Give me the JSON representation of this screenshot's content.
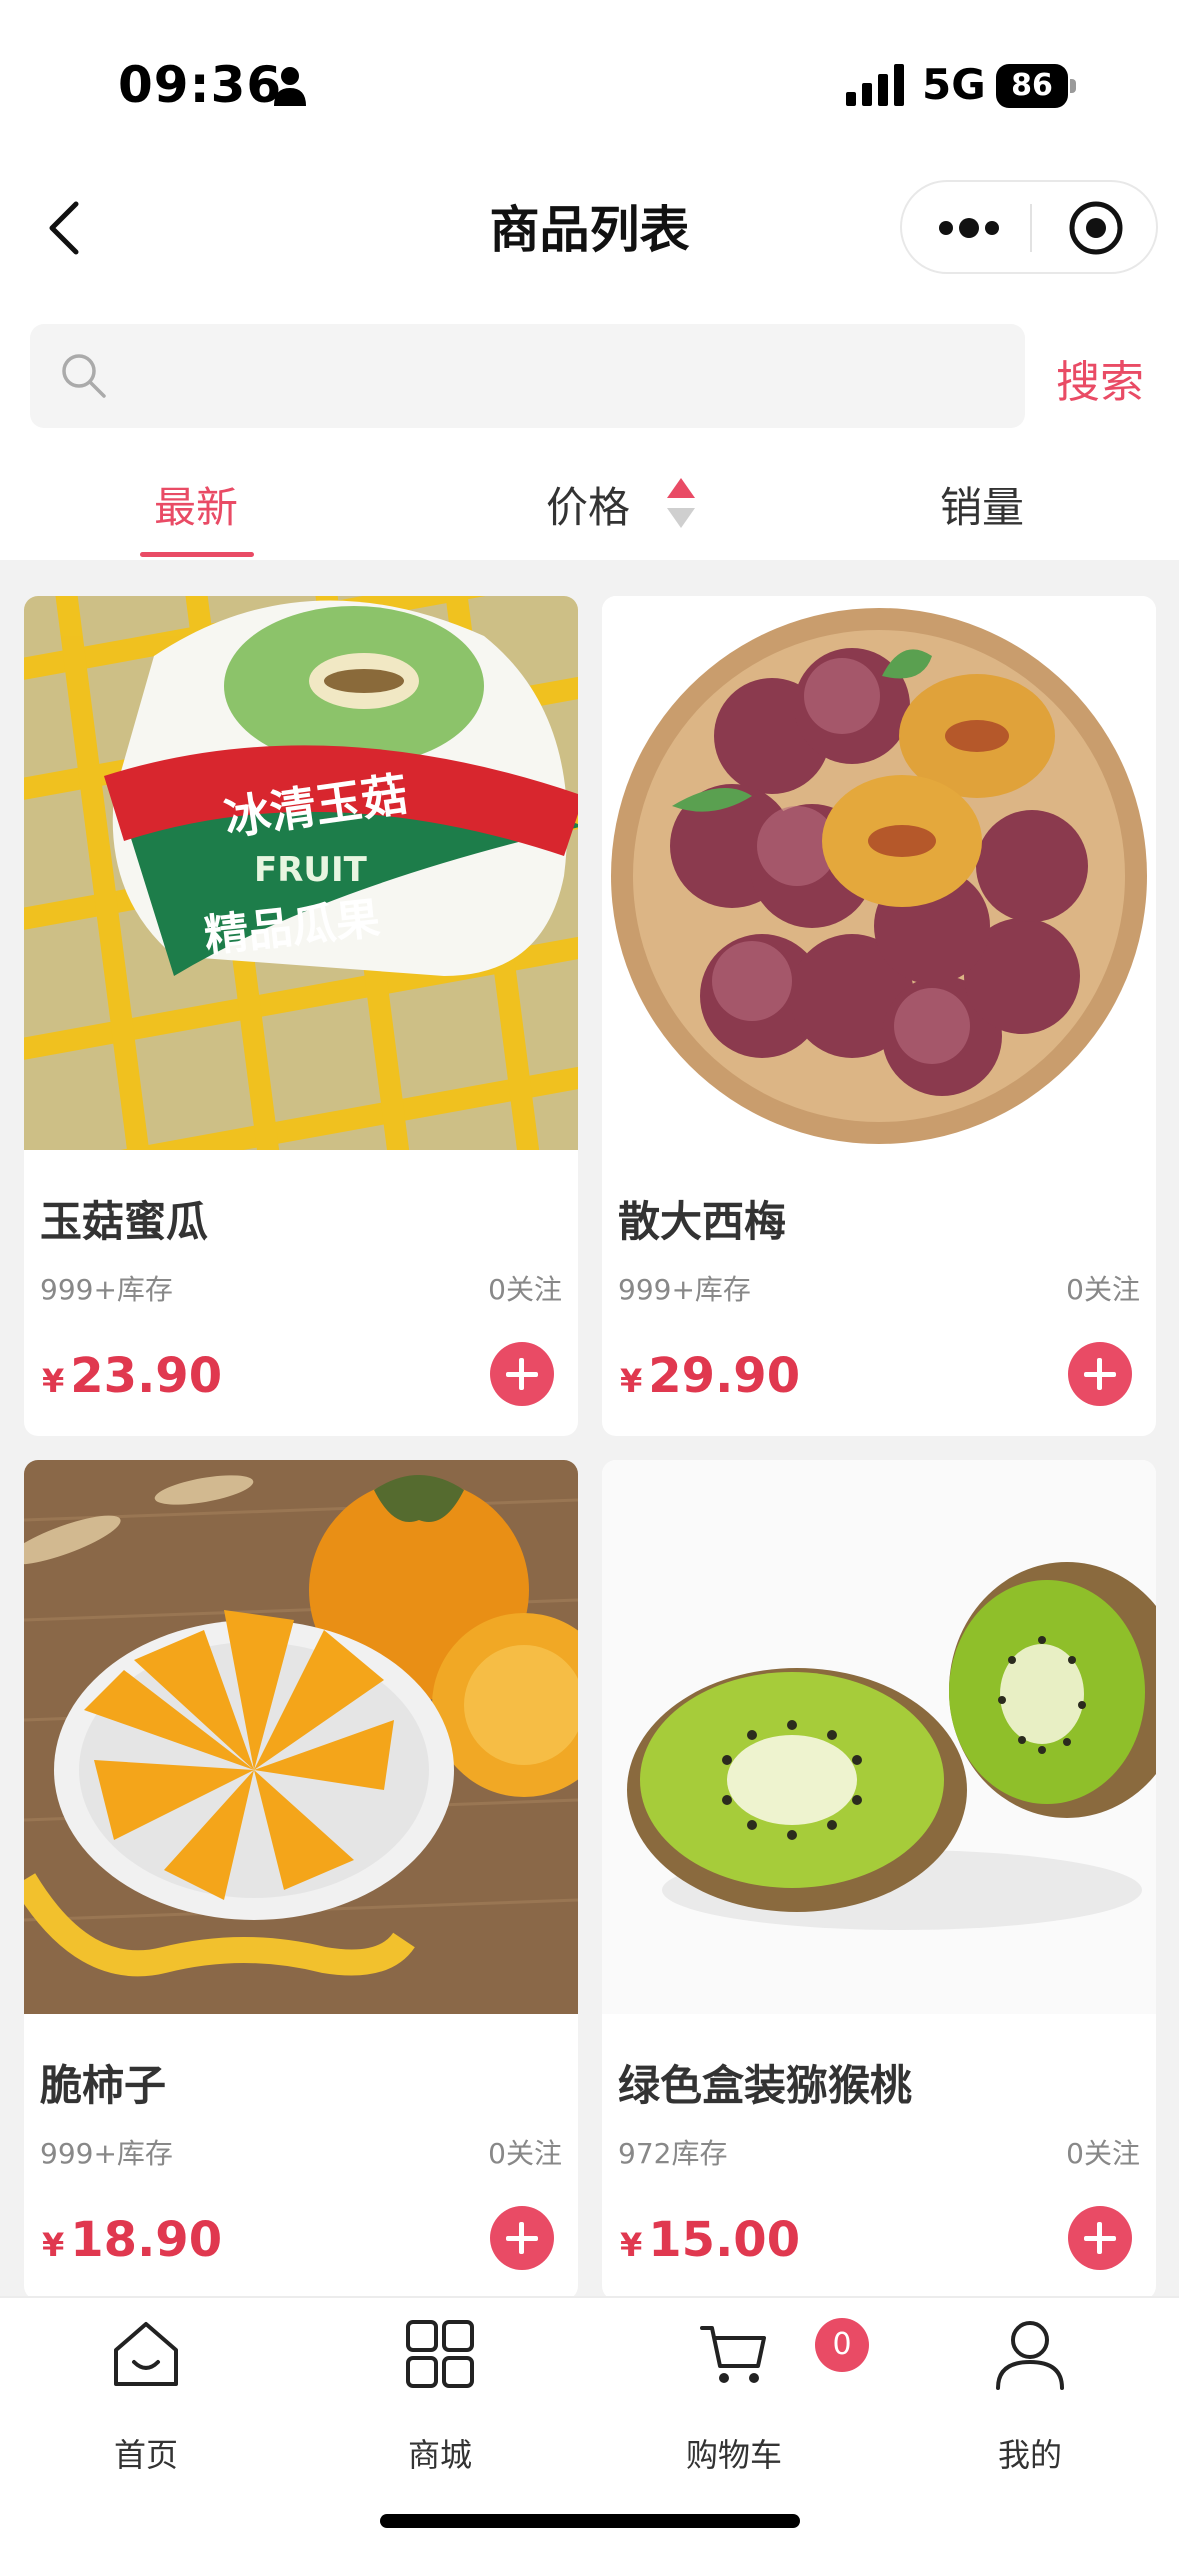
{
  "status_bar": {
    "time": "09:36",
    "network": "5G",
    "battery": "86"
  },
  "nav": {
    "title": "商品列表"
  },
  "search": {
    "placeholder": "",
    "button_label": "搜索"
  },
  "sort_tabs": [
    {
      "label": "最新",
      "active": true
    },
    {
      "label": "价格",
      "active": false
    },
    {
      "label": "销量",
      "active": false
    }
  ],
  "products": [
    {
      "name": "玉菇蜜瓜",
      "stock": "999+库存",
      "follow": "0关注",
      "currency": "¥",
      "price": "23.90",
      "image": "melon-image",
      "image_text": [
        "冰清玉菇",
        "FRUIT",
        "精品瓜果"
      ]
    },
    {
      "name": "散大西梅",
      "stock": "999+库存",
      "follow": "0关注",
      "currency": "¥",
      "price": "29.90",
      "image": "plum-image"
    },
    {
      "name": "脆柿子",
      "stock": "999+库存",
      "follow": "0关注",
      "currency": "¥",
      "price": "18.90",
      "image": "persimmon-image"
    },
    {
      "name": "绿色盒装猕猴桃",
      "stock": "972库存",
      "follow": "0关注",
      "currency": "¥",
      "price": "15.00",
      "image": "kiwi-image"
    }
  ],
  "tabbar": {
    "items": [
      {
        "label": "首页",
        "icon": "home-icon"
      },
      {
        "label": "商城",
        "icon": "grid-icon"
      },
      {
        "label": "购物车",
        "icon": "cart-icon"
      },
      {
        "label": "我的",
        "icon": "user-icon"
      }
    ],
    "cart_count": "0"
  },
  "colors": {
    "accent": "#e94b65",
    "price": "#e0384f",
    "background": "#f2f2f2"
  }
}
